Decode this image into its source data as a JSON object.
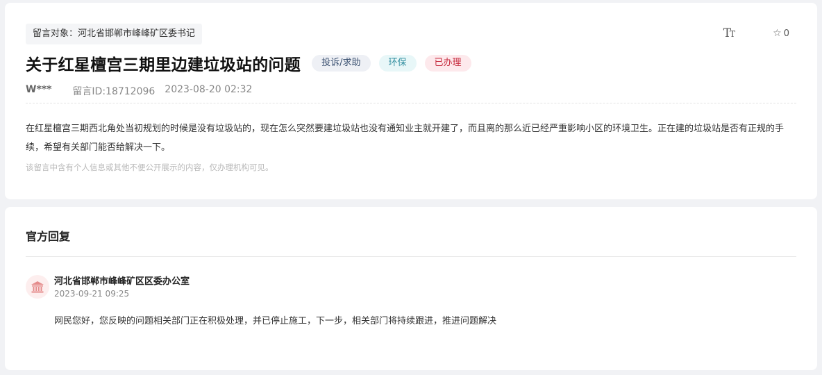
{
  "message": {
    "target_label": "留言对象：河北省邯郸市峰峰矿区委书记",
    "title": "关于红星檀宫三期里边建垃圾站的问题",
    "badges": {
      "category": "投诉/求助",
      "topic": "环保",
      "status": "已办理"
    },
    "author": "W***",
    "message_id": "留言ID:18712096",
    "datetime": "2023-08-20 02:32",
    "body": "在红星檀宫三期西北角处当初规划的时候是没有垃圾站的，现在怎么突然要建垃圾站也没有通知业主就开建了，而且离的那么近已经严重影响小区的环境卫生。正在建的垃圾站是否有正规的手续，希望有关部门能否给解决一下。",
    "privacy_notice": "该留言中含有个人信息或其他不便公开展示的内容，仅办理机构可见。"
  },
  "toolbar": {
    "font_size_glyph_big": "T",
    "font_size_glyph_small": "T",
    "favorite_count": "0"
  },
  "reply": {
    "heading": "官方回复",
    "org_name": "河北省邯郸市峰峰矿区区委办公室",
    "datetime": "2023-09-21 09:25",
    "content": "网民您好，您反映的问题相关部门正在积极处理，并已停止施工，下一步，相关部门将持续跟进，推进问题解决"
  },
  "icons": {
    "font_size": "font-size-icon",
    "favorite": "star-outline-icon",
    "organization": "government-building-icon"
  },
  "colors": {
    "page_background": "#f1f2f5",
    "category_badge_bg": "#eef0f5",
    "topic_badge_text": "#338fa0",
    "status_badge_text": "#c62b3e",
    "org_icon_color": "#e58c8c"
  }
}
